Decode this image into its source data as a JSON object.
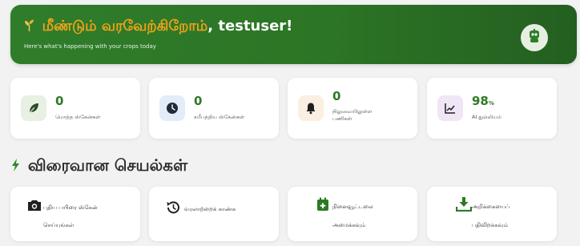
{
  "header": {
    "greeting": "மீண்டும் வரவேற்கிறோம்",
    "comma": ",",
    "username": "testuser",
    "exclaim": "!",
    "subtitle": "Here's what's happening with your crops today",
    "sprout_icon": "sprout-icon",
    "avatar_icon": "robot-avatar-icon",
    "colors": {
      "banner": "#2f7d2a",
      "greeting": "#f2a21a"
    }
  },
  "stats": [
    {
      "value": "0",
      "label": "மொத்த ஸ்கேன்கள்",
      "icon": "leaf-icon"
    },
    {
      "value": "0",
      "label": "சமீபத்திய ஸ்கேன்கள்",
      "icon": "clock-icon"
    },
    {
      "value": "0",
      "label": "நிலுவையிலுள்ள பணிகள்",
      "icon": "bell-icon"
    },
    {
      "value": "98",
      "unit": "%",
      "label": "AI துல்லியம்",
      "icon": "chart-line-icon"
    }
  ],
  "quick_actions": {
    "title": "விரைவான செயல்கள்",
    "icon": "bolt-icon",
    "items": [
      {
        "label_line1": "புதிய பயிரை ஸ்கேன்",
        "label_line2": "செய்யுங்கள்",
        "icon": "camera-icon"
      },
      {
        "label_line1": "வரலாற்றைக் காண்க",
        "label_line2": "",
        "icon": "history-icon"
      },
      {
        "label_line1": "நினைவூட்டலை",
        "label_line2": "அமைக்கவும்",
        "icon": "calendar-plus-icon"
      },
      {
        "label_line1": "அறிக்கையைப்",
        "label_line2": "பதிவிறக்கவும்",
        "icon": "download-icon"
      }
    ]
  }
}
